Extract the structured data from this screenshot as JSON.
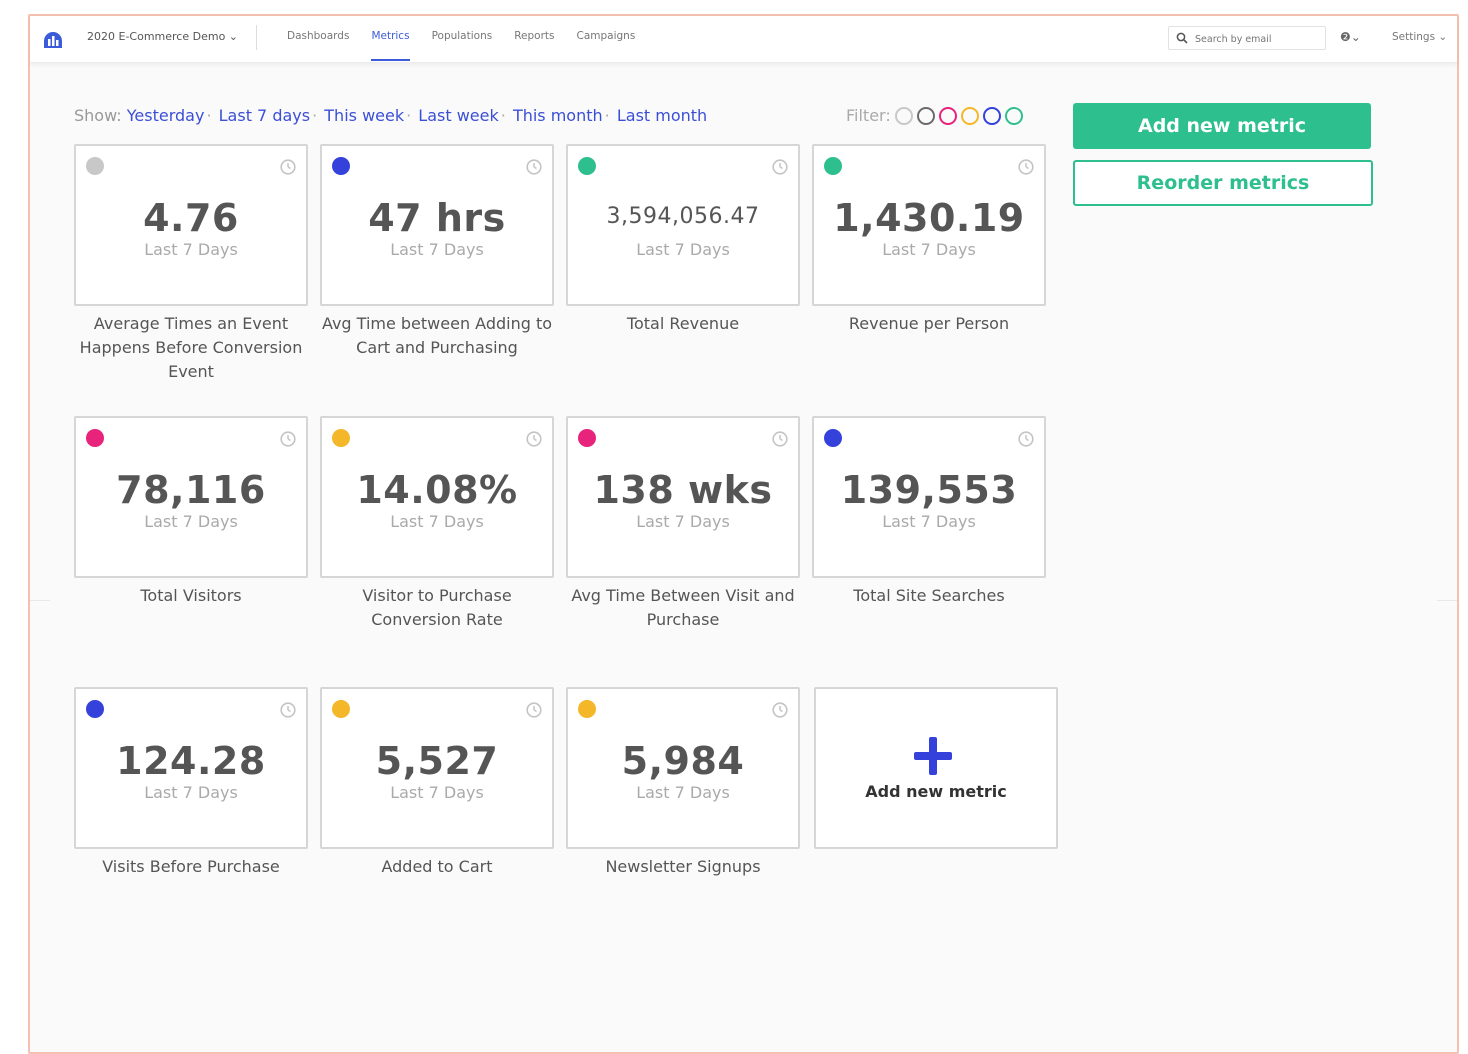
{
  "topbar": {
    "project": "2020 E-Commerce Demo ⌄",
    "nav": [
      "Dashboards",
      "Metrics",
      "Populations",
      "Reports",
      "Campaigns"
    ],
    "active_nav": "Metrics",
    "search_placeholder": "Search by email",
    "help_label": "❷⌄",
    "settings_label": "Settings ⌄"
  },
  "toolbar": {
    "show_label": "Show:",
    "ranges": [
      "Yesterday",
      "Last 7 days",
      "This week",
      "Last week",
      "This month",
      "Last month"
    ],
    "filter_label": "Filter:",
    "filter_colors": [
      "#c8c8c8",
      "#6b6b6b",
      "#e8237b",
      "#f5b72a",
      "#3442db",
      "#2ebf8e"
    ]
  },
  "actions": {
    "add_metric": "Add new metric",
    "reorder_metrics": "Reorder metrics"
  },
  "metrics": [
    {
      "value": "4.76",
      "period": "Last 7 Days",
      "name": "Average Times an Event Happens Before Conversion Event",
      "color": "#c8c8c8"
    },
    {
      "value": "47 hrs",
      "period": "Last 7 Days",
      "name": "Avg Time between Adding to Cart and Purchasing",
      "color": "#3442db"
    },
    {
      "value": "3,594,056.47",
      "period": "Last 7 Days",
      "name": "Total Revenue",
      "color": "#2ebf8e"
    },
    {
      "value": "1,430.19",
      "period": "Last 7 Days",
      "name": "Revenue per Person",
      "color": "#2ebf8e"
    },
    {
      "value": "78,116",
      "period": "Last 7 Days",
      "name": "Total Visitors",
      "color": "#e8237b"
    },
    {
      "value": "14.08%",
      "period": "Last 7 Days",
      "name": "Visitor to Purchase Conversion Rate",
      "color": "#f5b72a"
    },
    {
      "value": "138 wks",
      "period": "Last 7 Days",
      "name": "Avg Time Between Visit and Purchase",
      "color": "#e8237b"
    },
    {
      "value": "139,553",
      "period": "Last 7 Days",
      "name": "Total Site Searches",
      "color": "#3442db"
    },
    {
      "value": "124.28",
      "period": "Last 7 Days",
      "name": "Visits Before Purchase",
      "color": "#3442db"
    },
    {
      "value": "5,527",
      "period": "Last 7 Days",
      "name": "Added to Cart",
      "color": "#f5b72a"
    },
    {
      "value": "5,984",
      "period": "Last 7 Days",
      "name": "Newsletter Signups",
      "color": "#f5b72a"
    }
  ],
  "add_card": {
    "label": "Add new metric"
  }
}
